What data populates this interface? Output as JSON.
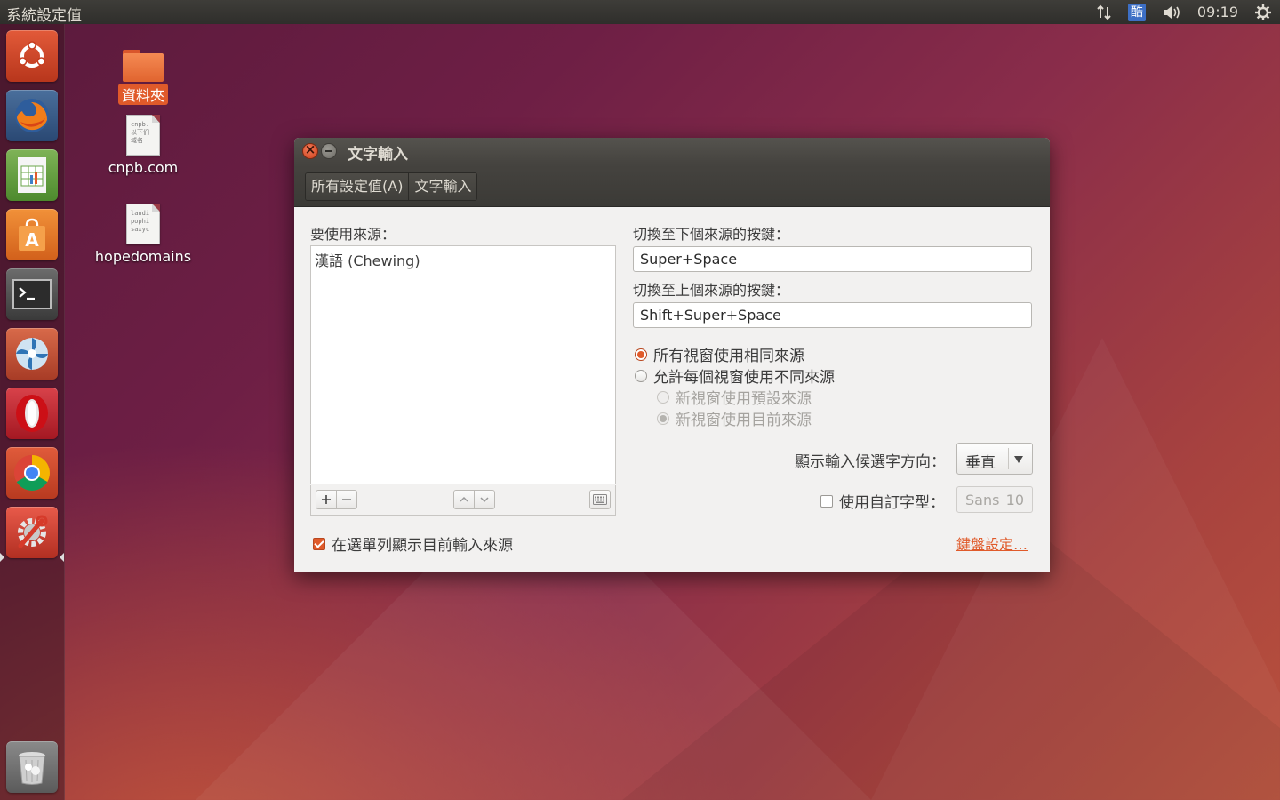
{
  "panel": {
    "app_title": "系統設定值",
    "ime_indicator": "酷",
    "clock": "09:19"
  },
  "launcher": {
    "items": [
      {
        "name": "ubuntu-dash",
        "icon": "ubuntu-logo-icon"
      },
      {
        "name": "firefox",
        "icon": "firefox-icon"
      },
      {
        "name": "libreoffice-calc",
        "icon": "spreadsheet-icon"
      },
      {
        "name": "ubuntu-software-center",
        "icon": "shopping-bag-icon"
      },
      {
        "name": "terminal",
        "icon": "terminal-icon"
      },
      {
        "name": "shotwell",
        "icon": "shotwell-icon"
      },
      {
        "name": "opera",
        "icon": "opera-icon"
      },
      {
        "name": "chrome",
        "icon": "chrome-icon"
      },
      {
        "name": "system-settings",
        "icon": "settings-icon"
      },
      {
        "name": "trash",
        "icon": "trash-icon"
      }
    ]
  },
  "desktop": {
    "folder_label": "資料夾",
    "file1": {
      "label": "cnpb.com",
      "preview": [
        "cnpb.",
        "以下们",
        "域名"
      ]
    },
    "file2": {
      "label": "hopedomains",
      "preview": [
        "landi",
        "pophi",
        "saxyc"
      ]
    }
  },
  "window": {
    "title": "文字輸入",
    "breadcrumb": [
      "所有設定值(A)",
      "文字輸入"
    ],
    "sources_label": "要使用來源：",
    "sources": [
      "漢語 (Chewing)"
    ],
    "next_key_label": "切換至下個來源的按鍵：",
    "next_key_value": "Super+Space",
    "prev_key_label": "切換至上個來源的按鍵：",
    "prev_key_value": "Shift+Super+Space",
    "radio_same": "所有視窗使用相同來源",
    "radio_per_window": "允許每個視窗使用不同來源",
    "radio_default_source": "新視窗使用預設來源",
    "radio_current_source": "新視窗使用目前來源",
    "candidate_orientation_label": "顯示輸入候選字方向：",
    "candidate_orientation_value": "垂直",
    "custom_font_label": "使用自訂字型：",
    "font_name": "Sans",
    "font_size": "10",
    "show_in_menubar_label": "在選單列顯示目前輸入來源",
    "keyboard_settings_link": "鍵盤設定…"
  },
  "colors": {
    "accent": "#e05a2a",
    "panel_bg": "#3a3935",
    "window_bg": "#f2f1f0"
  }
}
